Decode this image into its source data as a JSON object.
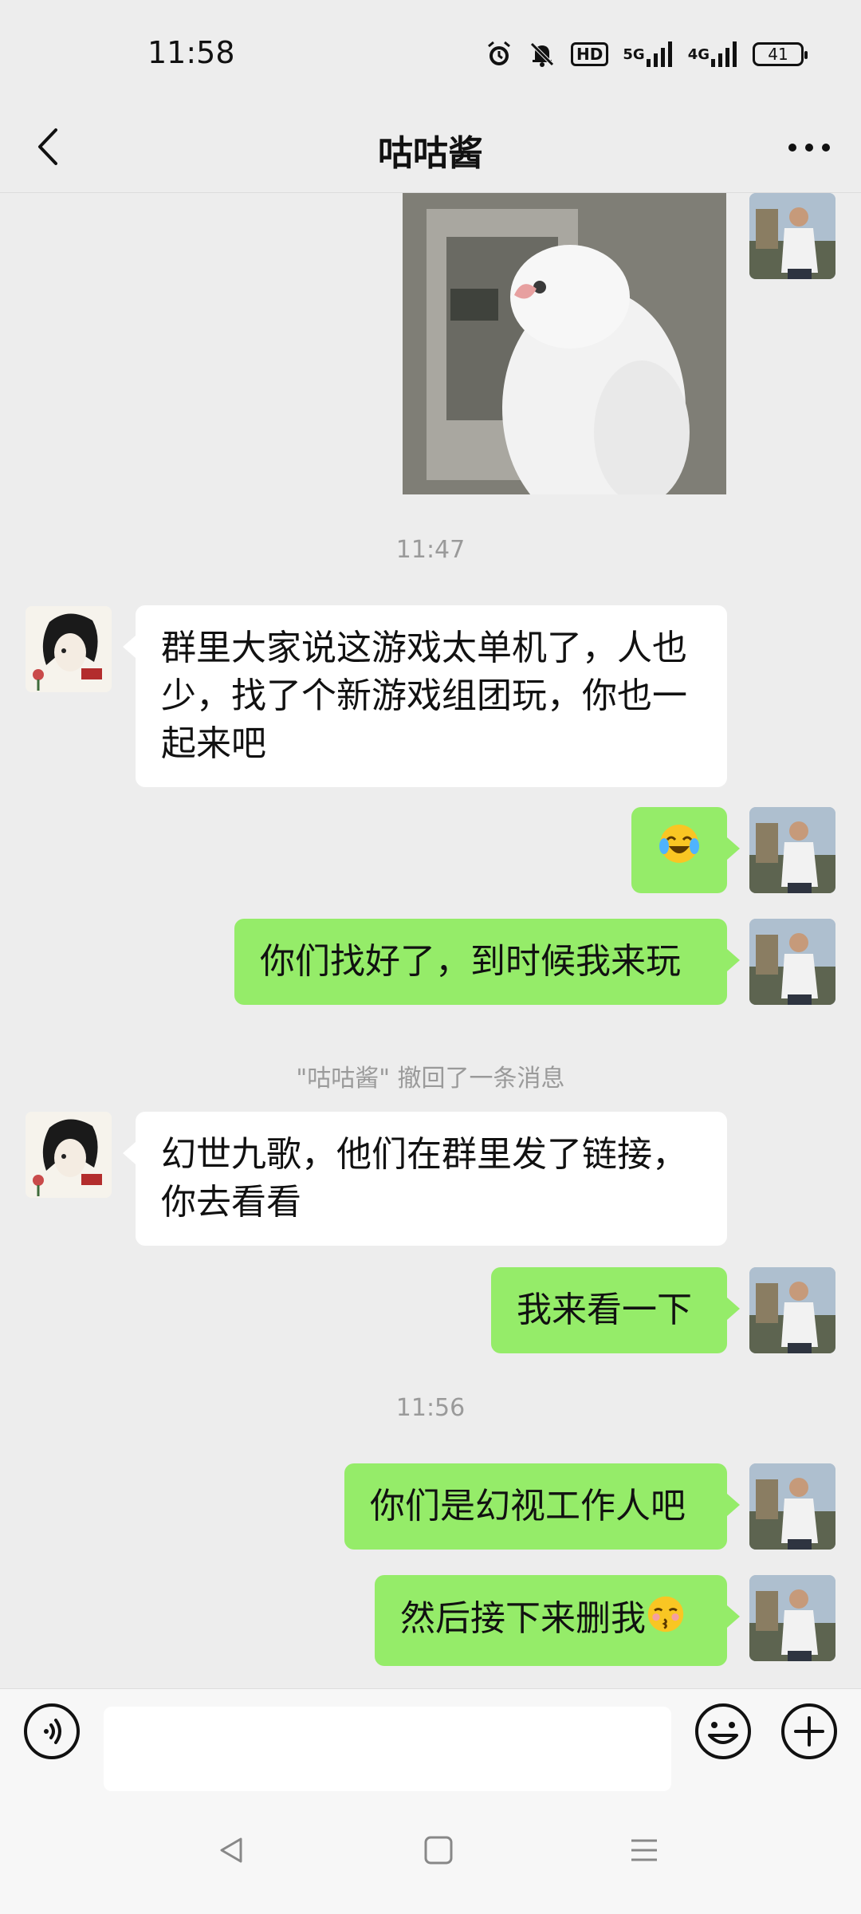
{
  "status_bar": {
    "time": "11:58",
    "hd": "HD",
    "net_5g": "5G",
    "net_4g": "4G",
    "battery": "41",
    "icons": [
      "alarm-icon",
      "mute-icon",
      "hd-icon",
      "signal-5g-icon",
      "signal-4g-icon",
      "battery-icon"
    ]
  },
  "header": {
    "title": "咕咕酱",
    "back_icon": "back-icon",
    "more_icon": "more-icon"
  },
  "messages": [
    {
      "type": "image",
      "side": "out",
      "content": "white bird sticker"
    },
    {
      "type": "timestamp",
      "text": "11:47"
    },
    {
      "type": "text",
      "side": "in",
      "text": "群里大家说这游戏太单机了，人也少，找了个新游戏组团玩，你也一起来吧"
    },
    {
      "type": "emoji",
      "side": "out",
      "emoji": "crying-laughing-face"
    },
    {
      "type": "text",
      "side": "out",
      "text": "你们找好了，到时候我来玩"
    },
    {
      "type": "system",
      "text": "\"咕咕酱\" 撤回了一条消息"
    },
    {
      "type": "text",
      "side": "in",
      "text": "幻世九歌，他们在群里发了链接，你去看看"
    },
    {
      "type": "text",
      "side": "out",
      "text": "我来看一下"
    },
    {
      "type": "timestamp",
      "text": "11:56"
    },
    {
      "type": "text",
      "side": "out",
      "text": "你们是幻视工作人吧"
    },
    {
      "type": "text",
      "side": "out",
      "text": "然后接下来删我",
      "trailing_emoji": "kissing-face"
    }
  ],
  "input_bar": {
    "value": "",
    "placeholder": "",
    "voice_icon": "voice-icon",
    "emoji_icon": "emoji-icon",
    "plus_icon": "plus-icon"
  },
  "nav_bar": {
    "icons": [
      "nav-back-icon",
      "nav-home-icon",
      "nav-menu-icon"
    ]
  },
  "colors": {
    "background": "#ededed",
    "outgoing_bubble": "#95ec69",
    "incoming_bubble": "#ffffff",
    "system_text": "#9a9a9a"
  }
}
